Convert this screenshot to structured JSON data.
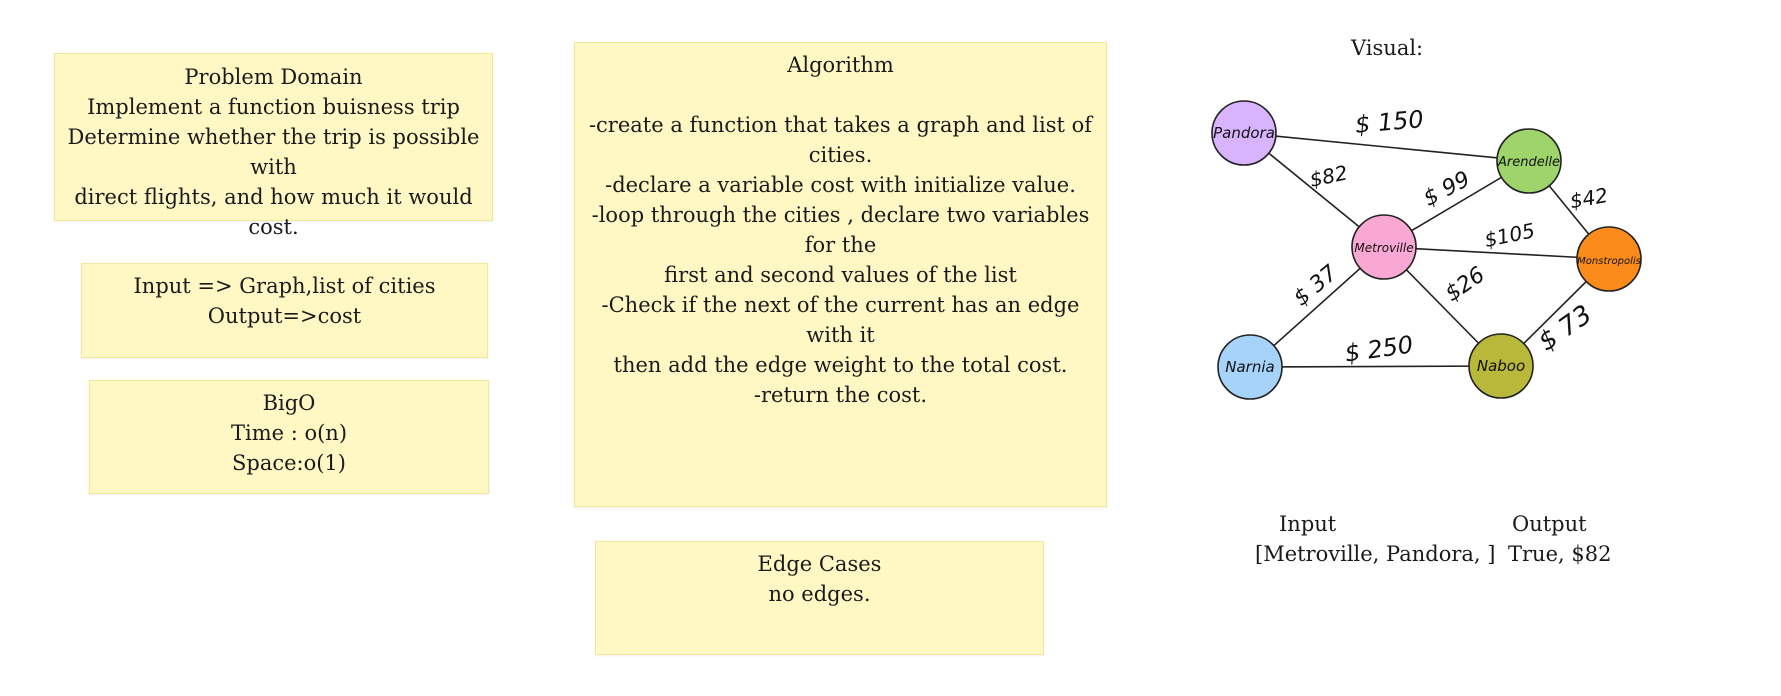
{
  "problem_domain": {
    "title": "Problem Domain",
    "lines": [
      "Implement a function buisness trip",
      "Determine whether the trip is possible with",
      "direct flights, and how much it would cost."
    ]
  },
  "io_note": {
    "input": "Input => Graph,list of cities",
    "output": "Output=>cost"
  },
  "big_o": {
    "title": "BigO",
    "time": "Time : o(n)",
    "space": "Space:o(1)"
  },
  "algorithm": {
    "title": "Algorithm",
    "lines": [
      "-create a function that takes a graph and list of cities.",
      "-declare a variable cost with initialize value.",
      "-loop through the cities , declare two variables for the",
      "first and second values of the list",
      "-Check if the next of the current has an edge with it",
      "then add the edge weight to the total cost.",
      "-return the cost."
    ]
  },
  "edge_cases": {
    "title": "Edge Cases",
    "text": "no edges."
  },
  "visual": {
    "title": "Visual:",
    "nodes": [
      {
        "id": "pandora",
        "label": "Pandora",
        "color": "#d8b4fe"
      },
      {
        "id": "arendelle",
        "label": "Arendelle",
        "color": "#9ed46a"
      },
      {
        "id": "metroville",
        "label": "Metroville",
        "color": "#f9a8d4"
      },
      {
        "id": "monstropolis",
        "label": "Monstropolis",
        "color": "#fb8c1c"
      },
      {
        "id": "narnia",
        "label": "Narnia",
        "color": "#a7d3fb"
      },
      {
        "id": "naboo",
        "label": "Naboo",
        "color": "#b8b83a"
      }
    ],
    "edges": [
      {
        "from": "pandora",
        "to": "arendelle",
        "label": "$ 150"
      },
      {
        "from": "pandora",
        "to": "metroville",
        "label": "$82"
      },
      {
        "from": "metroville",
        "to": "arendelle",
        "label": "$ 99"
      },
      {
        "from": "arendelle",
        "to": "monstropolis",
        "label": "$42"
      },
      {
        "from": "metroville",
        "to": "monstropolis",
        "label": "$105"
      },
      {
        "from": "metroville",
        "to": "narnia",
        "label": "$ 37"
      },
      {
        "from": "metroville",
        "to": "naboo",
        "label": "$26"
      },
      {
        "from": "narnia",
        "to": "naboo",
        "label": "$ 250"
      },
      {
        "from": "naboo",
        "to": "monstropolis",
        "label": "$ 73"
      }
    ]
  },
  "example": {
    "input_header": "Input",
    "input_value": "[Metroville, Pandora, ]",
    "output_header": "Output",
    "output_value": "True, $82"
  }
}
